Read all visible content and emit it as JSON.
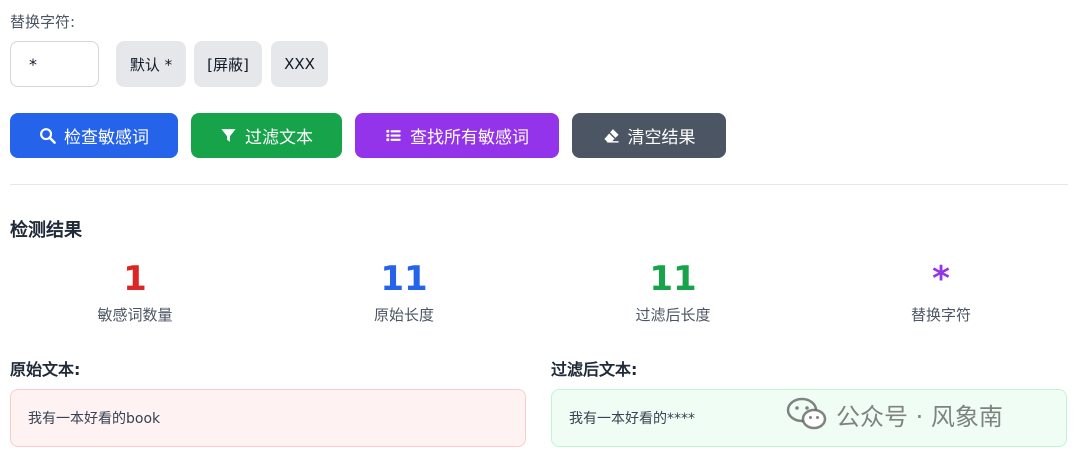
{
  "replace_section": {
    "label": "替换字符:",
    "input_value": "*",
    "presets": [
      "默认 *",
      "[屏蔽]",
      "XXX"
    ]
  },
  "actions": {
    "check": "检查敏感词",
    "filter": "过滤文本",
    "find_all": "查找所有敏感词",
    "clear": "清空结果"
  },
  "results": {
    "title": "检测结果",
    "stats": [
      {
        "value": "1",
        "label": "敏感词数量",
        "color": "#dc2626"
      },
      {
        "value": "11",
        "label": "原始长度",
        "color": "#2563eb"
      },
      {
        "value": "11",
        "label": "过滤后长度",
        "color": "#16a34a"
      },
      {
        "value": "*",
        "label": "替换字符",
        "color": "#9333ea"
      }
    ]
  },
  "texts": {
    "original_title": "原始文本:",
    "original_text": "我有一本好看的book",
    "filtered_title": "过滤后文本:",
    "filtered_text": "我有一本好看的****"
  },
  "watermark": {
    "text": "公众号 · 风象南"
  },
  "icons": {
    "check": "search-icon",
    "filter": "filter-icon",
    "find_all": "list-icon",
    "clear": "eraser-icon",
    "watermark": "wechat-icon"
  }
}
